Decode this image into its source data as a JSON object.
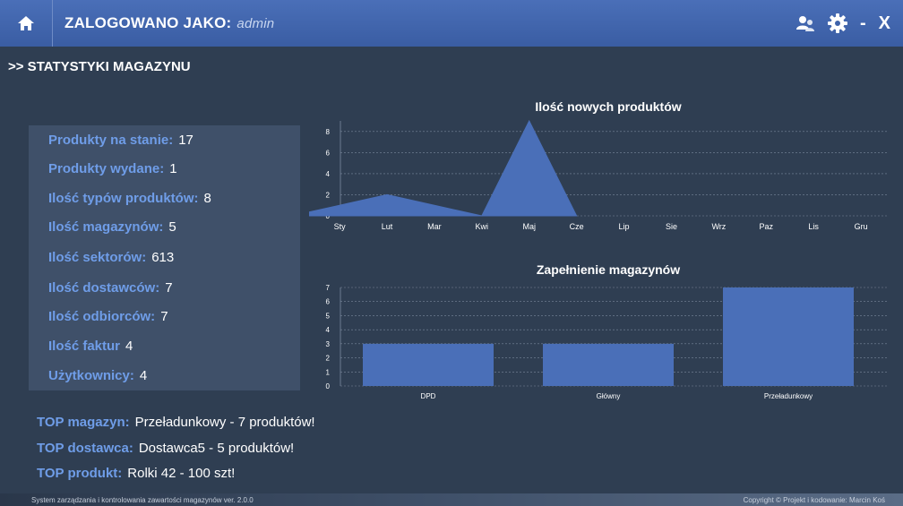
{
  "header": {
    "login_label": "ZALOGOWANO JAKO:",
    "username": "admin",
    "minimize": "-",
    "close": "X"
  },
  "section_title": ">> STATYSTYKI MAGAZYNU",
  "stats": [
    {
      "label": "Produkty na stanie:",
      "value": "17"
    },
    {
      "label": "Produkty wydane:",
      "value": "1"
    },
    {
      "label": "Ilość typów produktów:",
      "value": "8"
    },
    {
      "label": "Ilość magazynów:",
      "value": "5"
    },
    {
      "label": "Ilość sektorów:",
      "value": "613"
    },
    {
      "label": "Ilość dostawców:",
      "value": "7"
    },
    {
      "label": "Ilość odbiorców:",
      "value": "7"
    },
    {
      "label": "Ilość faktur",
      "value": "4"
    },
    {
      "label": "Użytkownicy:",
      "value": "4"
    }
  ],
  "top": [
    {
      "label": "TOP magazyn:",
      "value": "Przeładunkowy - 7 produktów!"
    },
    {
      "label": "TOP dostawca:",
      "value": "Dostawca5 - 5 produktów!"
    },
    {
      "label": "TOP produkt:",
      "value": "Rolki 42 - 100 szt!"
    }
  ],
  "footer": {
    "left": "System zarządzania i kontrolowania zawartości magazynów ver. 2.0.0",
    "right": "Copyright © Projekt i kodowanie: Marcin Koś"
  },
  "chart_data": [
    {
      "type": "area",
      "title": "Ilość nowych produktów",
      "categories": [
        "Sty",
        "Lut",
        "Mar",
        "Kwi",
        "Maj",
        "Cze",
        "Lip",
        "Sie",
        "Wrz",
        "Paz",
        "Lis",
        "Gru"
      ],
      "values": [
        1,
        2,
        1,
        0,
        9,
        0,
        null,
        null,
        null,
        null,
        null,
        null
      ],
      "yticks": [
        0,
        2,
        4,
        6,
        8
      ],
      "ylim": [
        0,
        9
      ],
      "grid": true,
      "color": "#4a6fb8"
    },
    {
      "type": "bar",
      "title": "Zapełnienie magazynów",
      "categories": [
        "DPD",
        "Główny",
        "Przeładunkowy"
      ],
      "values": [
        3,
        3,
        7
      ],
      "yticks": [
        0,
        1,
        2,
        3,
        4,
        5,
        6,
        7
      ],
      "ylim": [
        0,
        7
      ],
      "grid": true,
      "color": "#4a6fb8"
    }
  ]
}
